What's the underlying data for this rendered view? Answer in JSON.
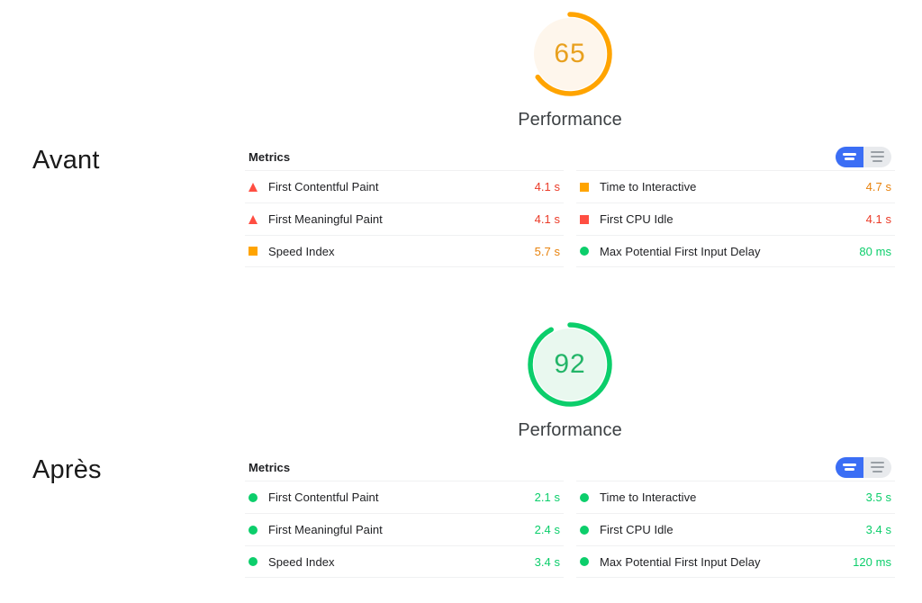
{
  "labels": {
    "before": "Avant",
    "after": "Après"
  },
  "colors": {
    "good": "#0cce6b",
    "average": "#ffa400",
    "poor": "#ff4e42",
    "value_good": "#0cce6b",
    "value_average": "#e8820c",
    "value_poor": "#eb3b28",
    "toggle_active": "#3b6ef5",
    "toggle_track": "#e8eaed"
  },
  "reports": [
    {
      "id": "before",
      "gauge": {
        "score": "65",
        "title": "Performance",
        "percent": 65,
        "ring_color": "#ffa400",
        "fill_color": "#fef6ec",
        "score_color": "#e8a01e"
      },
      "metrics_section": {
        "title": "Metrics",
        "toggle": {
          "active_name": "expanded-view-icon",
          "inactive_name": "list-view-icon"
        },
        "left_column": [
          {
            "icon": "triangle",
            "status": "poor",
            "name": "First Contentful Paint",
            "value": "4.1 s"
          },
          {
            "icon": "triangle",
            "status": "poor",
            "name": "First Meaningful Paint",
            "value": "4.1 s"
          },
          {
            "icon": "square",
            "status": "average",
            "name": "Speed Index",
            "value": "5.7 s"
          }
        ],
        "right_column": [
          {
            "icon": "square",
            "status": "average",
            "name": "Time to Interactive",
            "value": "4.7 s"
          },
          {
            "icon": "square",
            "status": "poor",
            "name": "First CPU Idle",
            "value": "4.1 s"
          },
          {
            "icon": "circle",
            "status": "good",
            "name": "Max Potential First Input Delay",
            "value": "80 ms"
          }
        ]
      }
    },
    {
      "id": "after",
      "gauge": {
        "score": "92",
        "title": "Performance",
        "percent": 92,
        "ring_color": "#0cce6b",
        "fill_color": "#e9f8ef",
        "score_color": "#23b568"
      },
      "metrics_section": {
        "title": "Metrics",
        "toggle": {
          "active_name": "expanded-view-icon",
          "inactive_name": "list-view-icon"
        },
        "left_column": [
          {
            "icon": "circle",
            "status": "good",
            "name": "First Contentful Paint",
            "value": "2.1 s"
          },
          {
            "icon": "circle",
            "status": "good",
            "name": "First Meaningful Paint",
            "value": "2.4 s"
          },
          {
            "icon": "circle",
            "status": "good",
            "name": "Speed Index",
            "value": "3.4 s"
          }
        ],
        "right_column": [
          {
            "icon": "circle",
            "status": "good",
            "name": "Time to Interactive",
            "value": "3.5 s"
          },
          {
            "icon": "circle",
            "status": "good",
            "name": "First CPU Idle",
            "value": "3.4 s"
          },
          {
            "icon": "circle",
            "status": "good",
            "name": "Max Potential First Input Delay",
            "value": "120 ms"
          }
        ]
      }
    }
  ]
}
